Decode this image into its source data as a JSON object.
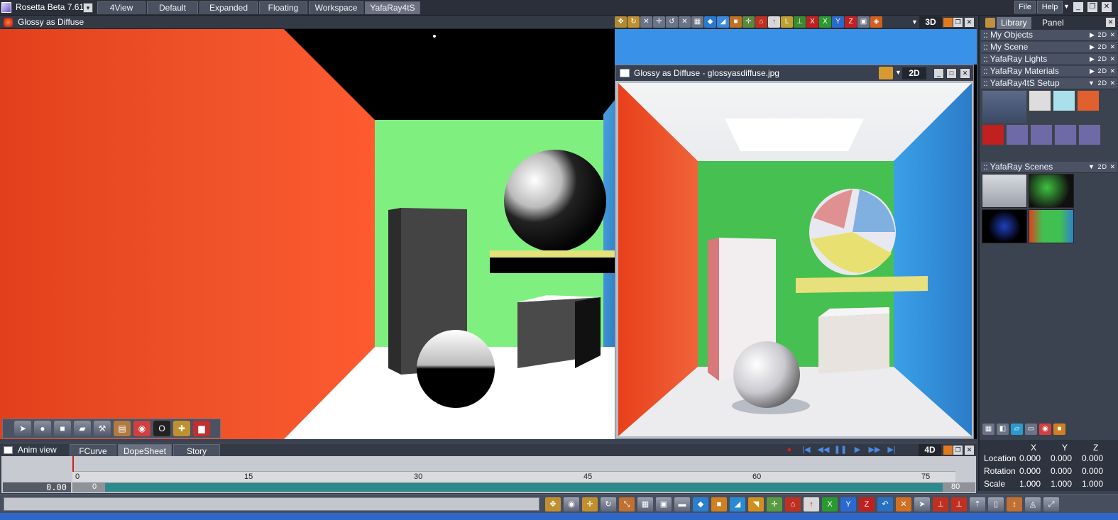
{
  "app": {
    "title": "Rosetta Beta 7.61",
    "menu_dropdown": "▾",
    "layout_tabs": [
      "4View",
      "Default",
      "Expanded",
      "Floating",
      "Workspace",
      "YafaRay4tS"
    ],
    "active_layout": "YafaRay4tS",
    "file_label": "File",
    "help_label": "Help"
  },
  "viewport": {
    "title": "Glossy as Diffuse",
    "mode_label": "3D"
  },
  "render_window": {
    "title": "Glossy as Diffuse - glossyasdiffuse.jpg",
    "mode_label": "2D"
  },
  "right_panel": {
    "tabs": [
      "Library",
      "Panel"
    ],
    "active_tab": "Library",
    "sections": [
      {
        "label": ":: My Objects",
        "mode": "2D"
      },
      {
        "label": ":: My Scene",
        "mode": "2D"
      },
      {
        "label": ":: YafaRay Lights",
        "mode": "2D"
      },
      {
        "label": ":: YafaRay Materials",
        "mode": "2D"
      },
      {
        "label": ":: YafaRay4tS Setup",
        "mode": "2D"
      },
      {
        "label": ":: YafaRay Scenes",
        "mode": "2D"
      }
    ]
  },
  "transform": {
    "axes": [
      "X",
      "Y",
      "Z"
    ],
    "rows": [
      {
        "label": "Location",
        "values": [
          "0.000",
          "0.000",
          "0.000"
        ]
      },
      {
        "label": "Rotation",
        "values": [
          "0.000",
          "0.000",
          "0.000"
        ]
      },
      {
        "label": "Scale",
        "values": [
          "1.000",
          "1.000",
          "1.000"
        ]
      }
    ]
  },
  "anim": {
    "title": "Anim view",
    "tabs": [
      "FCurve",
      "DopeSheet",
      "Story"
    ],
    "active_tab": "DopeSheet",
    "mode_label": "4D",
    "current_time": "0.00",
    "start_frame": "0",
    "end_frame": "80",
    "ticks": [
      "0",
      "15",
      "30",
      "45",
      "60",
      "75"
    ]
  },
  "colors": {
    "accent": "#2f67c9",
    "track_fill": "#2c8a8c",
    "playhead": "#d02020"
  }
}
